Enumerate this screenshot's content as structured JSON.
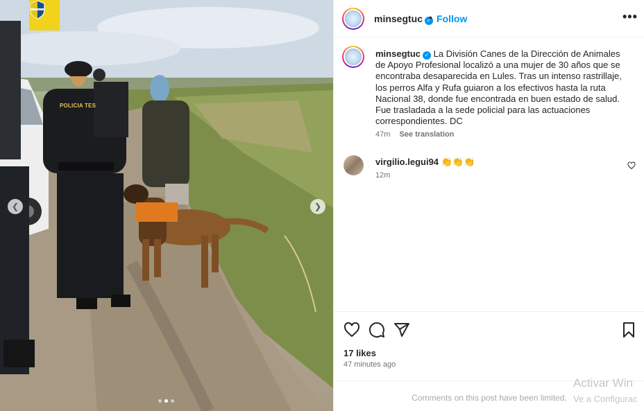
{
  "post": {
    "username": "minsegtuc",
    "follow_label": "Follow",
    "more_label": "•••",
    "separator": "•",
    "caption": "La División Canes de la Dirección de Animales de Apoyo Profesional localizó a una mujer de 30 años que se encontraba desaparecida en Lules. Tras un intenso rastrillaje, los perros Alfa y Rufa guiaron a los efectivos hasta la ruta Nacional 38, donde fue encontrada en buen estado de salud. Fue trasladada a la sede policial para las actuaciones correspondientes. DC",
    "caption_time": "47m",
    "see_translation": "See translation",
    "likes": "17 likes",
    "posted_ago": "47 minutes ago",
    "comments_limited": "Comments on this post have been limited."
  },
  "comments": [
    {
      "username": "virgilio.legui94",
      "text": "👏👏👏",
      "time": "12m"
    }
  ],
  "photo": {
    "vest_text": "POLICIA TES",
    "carousel_dots": 3,
    "active_dot": 1
  },
  "watermark": {
    "line1": "Activar Win",
    "line2": "Ve a Configurac"
  },
  "icons": {
    "badge": "shield-icon",
    "verified": "verified-badge-icon",
    "like": "heart-icon",
    "comment": "comment-icon",
    "share": "paper-plane-icon",
    "save": "bookmark-icon",
    "prev": "chevron-left-icon",
    "next": "chevron-right-icon"
  },
  "colors": {
    "accent": "#0095f6",
    "badge_bg": "#f2d21a",
    "muted_text": "#737373"
  }
}
